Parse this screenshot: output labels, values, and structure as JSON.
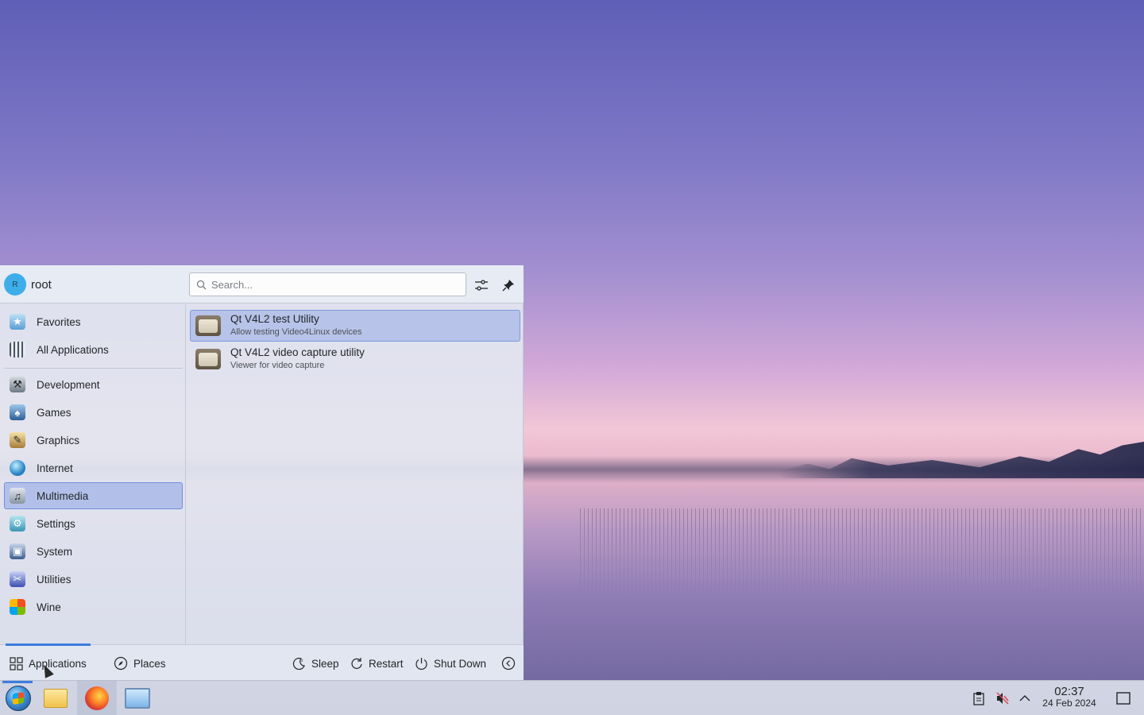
{
  "launcher": {
    "user": {
      "initial": "R",
      "name": "root"
    },
    "search": {
      "placeholder": "Search..."
    },
    "categories": [
      {
        "label": "Favorites",
        "icon": "star-folder-icon"
      },
      {
        "label": "All Applications",
        "icon": "grid-icon"
      },
      {
        "label": "Development",
        "icon": "development-icon"
      },
      {
        "label": "Games",
        "icon": "games-icon"
      },
      {
        "label": "Graphics",
        "icon": "graphics-icon"
      },
      {
        "label": "Internet",
        "icon": "globe-icon"
      },
      {
        "label": "Multimedia",
        "icon": "multimedia-icon",
        "active": true
      },
      {
        "label": "Settings",
        "icon": "settings-icon"
      },
      {
        "label": "System",
        "icon": "system-icon"
      },
      {
        "label": "Utilities",
        "icon": "utilities-icon"
      },
      {
        "label": "Wine",
        "icon": "wine-icon"
      }
    ],
    "apps": [
      {
        "name": "Qt V4L2 test Utility",
        "description": "Allow testing Video4Linux devices",
        "active": true
      },
      {
        "name": "Qt V4L2 video capture utility",
        "description": "Viewer for video capture"
      }
    ],
    "footer": {
      "applications": "Applications",
      "places": "Places",
      "sleep": "Sleep",
      "restart": "Restart",
      "shutdown": "Shut Down"
    }
  },
  "taskbar": {
    "clock": {
      "time": "02:37",
      "date": "24 Feb 2024"
    }
  },
  "colors": {
    "accent": "#3d7de0",
    "highlight": "#93aae6"
  }
}
